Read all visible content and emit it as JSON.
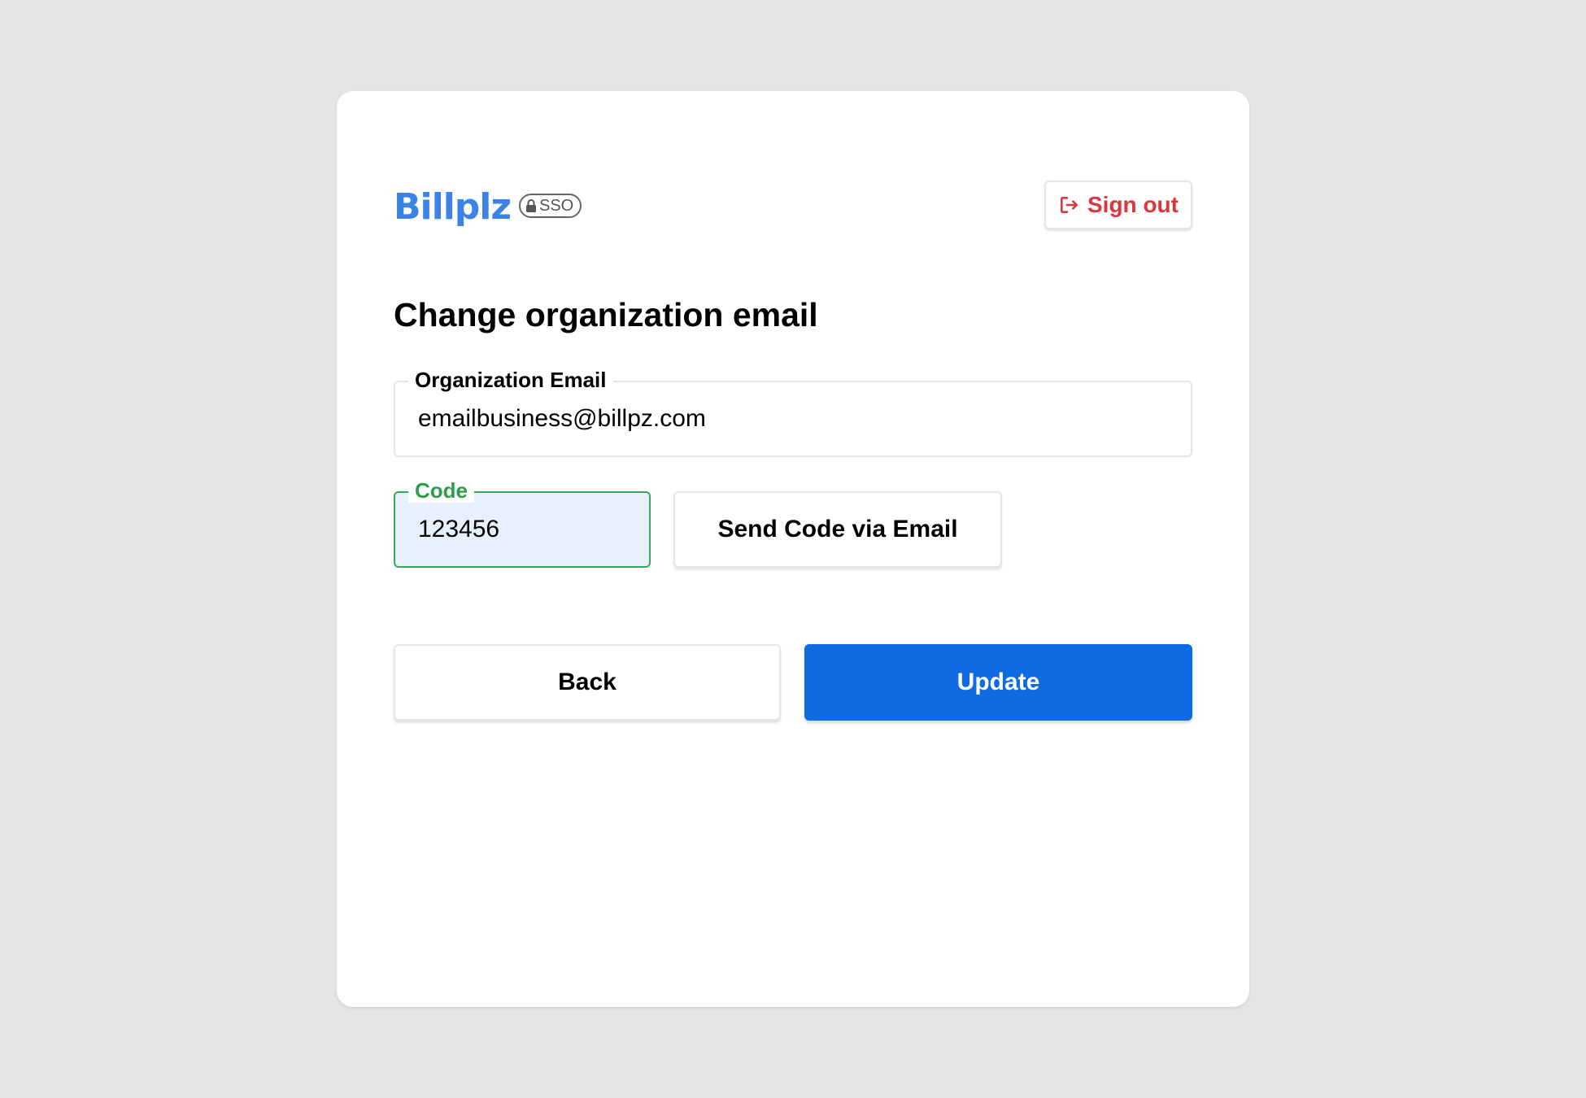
{
  "brand": {
    "name": "Billplz",
    "badge": "SSO",
    "color": "#3c84e4"
  },
  "header": {
    "sign_out_label": "Sign out",
    "sign_out_icon": "sign-out-icon",
    "sign_out_color": "#d9363e"
  },
  "page": {
    "title": "Change organization email"
  },
  "form": {
    "email": {
      "label": "Organization Email",
      "value": "emailbusiness@billpz.com"
    },
    "code": {
      "label": "Code",
      "value": "123456",
      "focus_color": "#3aa757"
    },
    "send_code_label": "Send Code via Email"
  },
  "actions": {
    "back_label": "Back",
    "update_label": "Update",
    "primary_color": "#0f6be3"
  }
}
